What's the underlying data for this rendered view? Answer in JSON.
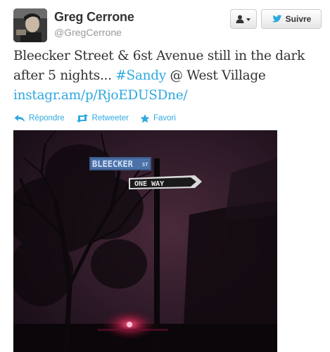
{
  "user": {
    "display_name": "Greg Cerrone",
    "screen_name": "@GregCerrone"
  },
  "buttons": {
    "follow_label": "Suivre",
    "user_menu_icon": "person-icon"
  },
  "tweet": {
    "text_before": "Bleecker Street & 6st Avenue still in the dark after 5 nights... ",
    "hashtag": "#Sandy",
    "text_after": " @ West Village",
    "link": "instagr.am/p/RjoEDUSDne/"
  },
  "actions": {
    "reply": "Répondre",
    "retweet": "Retweeter",
    "favorite": "Favori"
  },
  "photo": {
    "sign_street": "BLEECKER",
    "sign_street_suffix": "ST",
    "sign_oneway": "ONE WAY"
  },
  "colors": {
    "link": "#2fa9e0",
    "text": "#333333",
    "muted": "#999999"
  }
}
